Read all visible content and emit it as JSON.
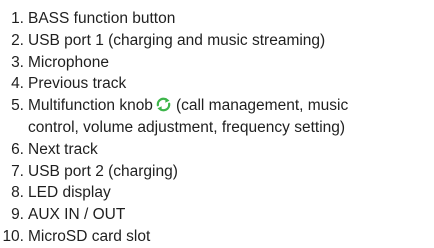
{
  "items": [
    {
      "num": "1.",
      "text": "BASS function button"
    },
    {
      "num": "2.",
      "text": "USB port 1 (charging and music streaming)"
    },
    {
      "num": "3.",
      "text": "Microphone"
    },
    {
      "num": "4.",
      "text": "Previous track"
    },
    {
      "num": "5.",
      "text_before": "Multifunction knob",
      "icon": "rotate-arrows-icon",
      "text_after": "(call management, music",
      "text_cont": "control, volume adjustment, frequency setting)"
    },
    {
      "num": "6.",
      "text": "Next track"
    },
    {
      "num": "7.",
      "text": "USB port 2 (charging)"
    },
    {
      "num": "8.",
      "text": "LED display"
    },
    {
      "num": "9.",
      "text": "AUX IN / OUT"
    },
    {
      "num": "10.",
      "text": "MicroSD card slot"
    }
  ],
  "colors": {
    "text": "#1f1f1f",
    "icon": "#3db54a"
  }
}
